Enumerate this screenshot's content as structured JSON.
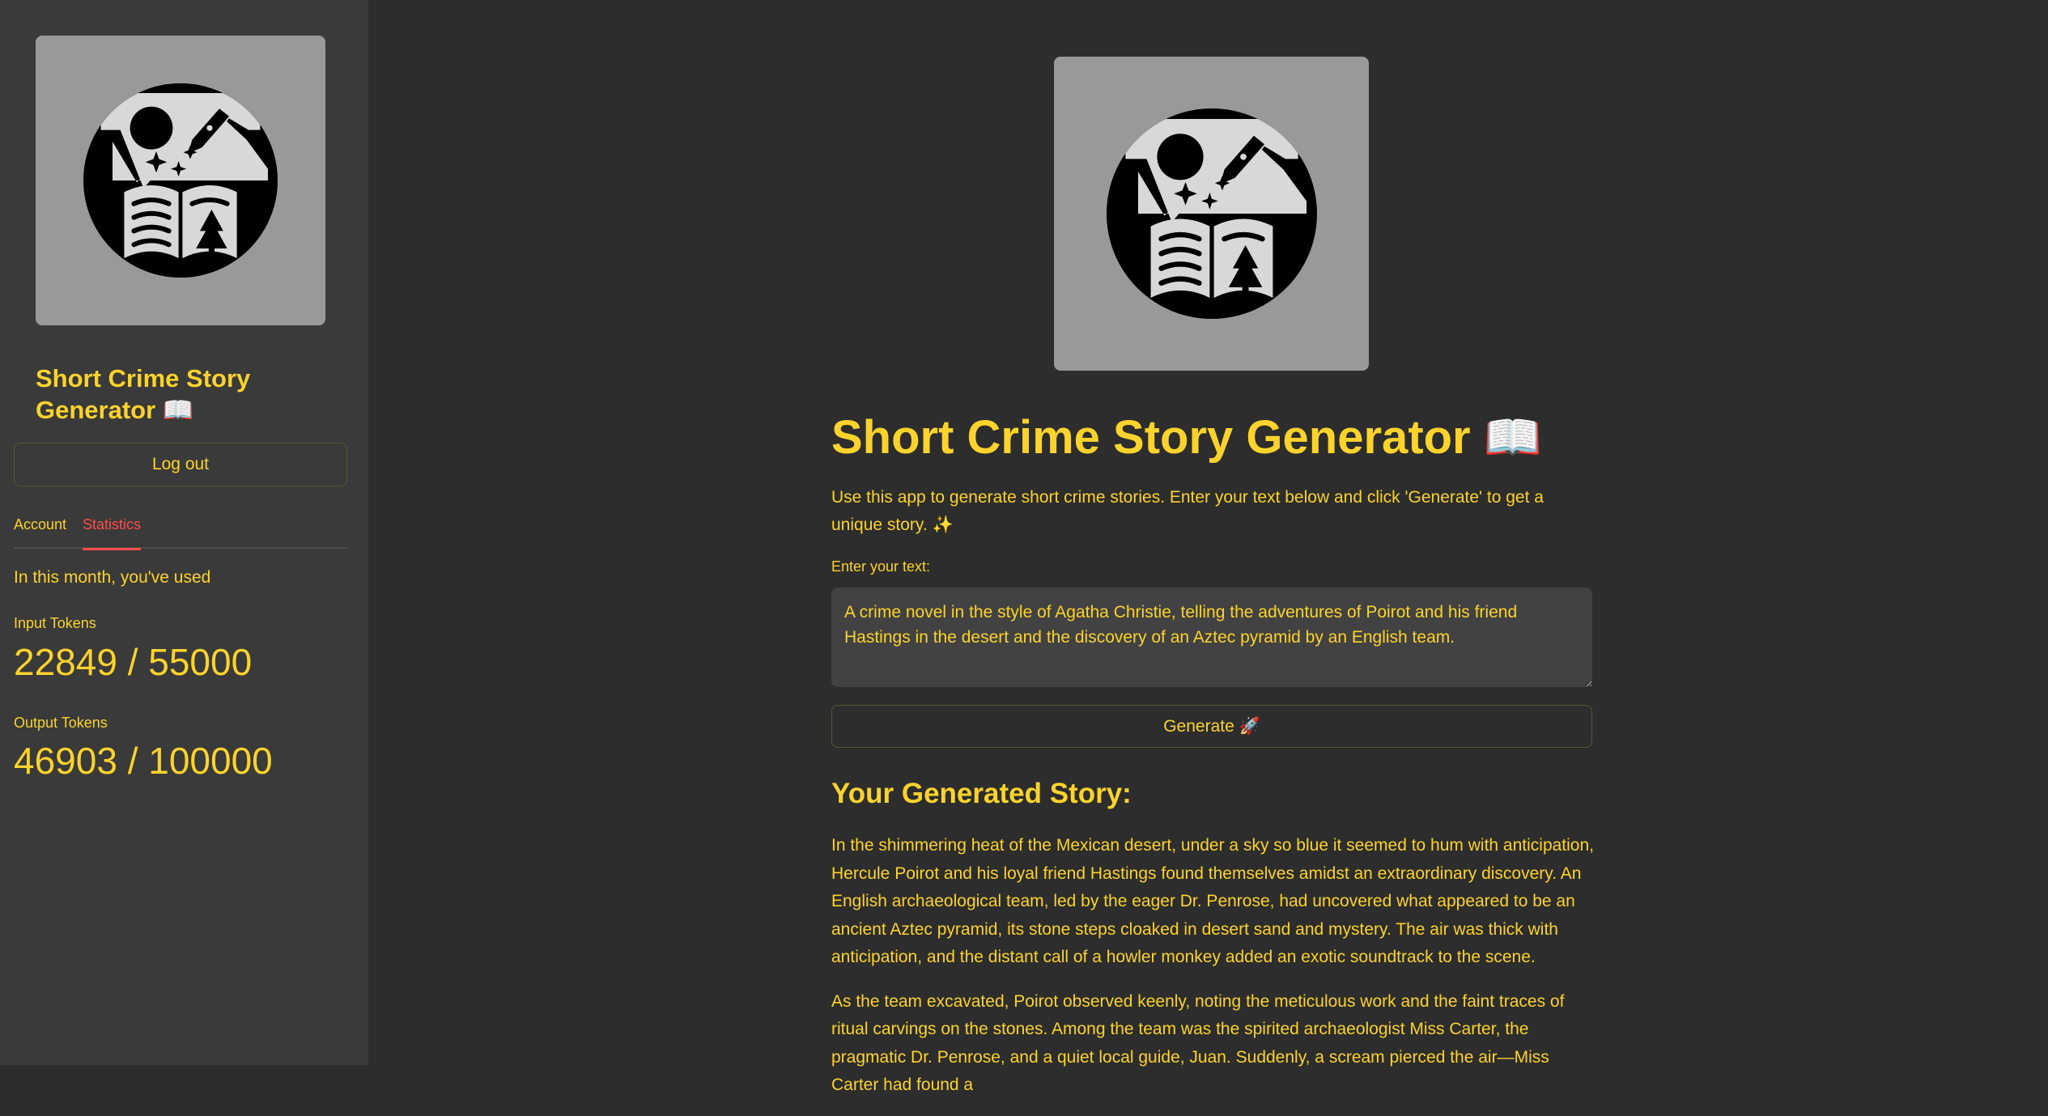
{
  "sidebar": {
    "title": "Short Crime Story Generator 📖",
    "logout_label": "Log out",
    "tabs": [
      {
        "label": "Account",
        "active": false
      },
      {
        "label": "Statistics",
        "active": true
      }
    ],
    "usage_intro": "In this month, you've used",
    "metrics": [
      {
        "label": "Input Tokens",
        "value": "22849 / 55000"
      },
      {
        "label": "Output Tokens",
        "value": "46903 / 100000"
      }
    ]
  },
  "main": {
    "logo_icon": "book-landscape-logo-icon",
    "title": "Short Crime Story Generator 📖",
    "intro": "Use this app to generate short crime stories. Enter your text below and click 'Generate' to get a unique story. ✨",
    "input_label": "Enter your text:",
    "input_value": "A crime novel in the style of Agatha Christie, telling the adventures of Poirot and his friend Hastings in the desert and the discovery of an Aztec pyramid by an English team.",
    "generate_label": "Generate 🚀",
    "story_heading": "Your Generated Story:",
    "story_paragraphs": [
      "In the shimmering heat of the Mexican desert, under a sky so blue it seemed to hum with anticipation, Hercule Poirot and his loyal friend Hastings found themselves amidst an extraordinary discovery. An English archaeological team, led by the eager Dr. Penrose, had uncovered what appeared to be an ancient Aztec pyramid, its stone steps cloaked in desert sand and mystery. The air was thick with anticipation, and the distant call of a howler monkey added an exotic soundtrack to the scene.",
      "As the team excavated, Poirot observed keenly, noting the meticulous work and the faint traces of ritual carvings on the stones. Among the team was the spirited archaeologist Miss Carter, the pragmatic Dr. Penrose, and a quiet local guide, Juan. Suddenly, a scream pierced the air—Miss Carter had found a"
    ]
  },
  "colors": {
    "accent": "#fcd32c",
    "active_tab": "#ff4b4b",
    "sidebar_bg": "#3a3a3a",
    "main_bg": "#2d2d2d",
    "logo_bg": "#999999"
  }
}
